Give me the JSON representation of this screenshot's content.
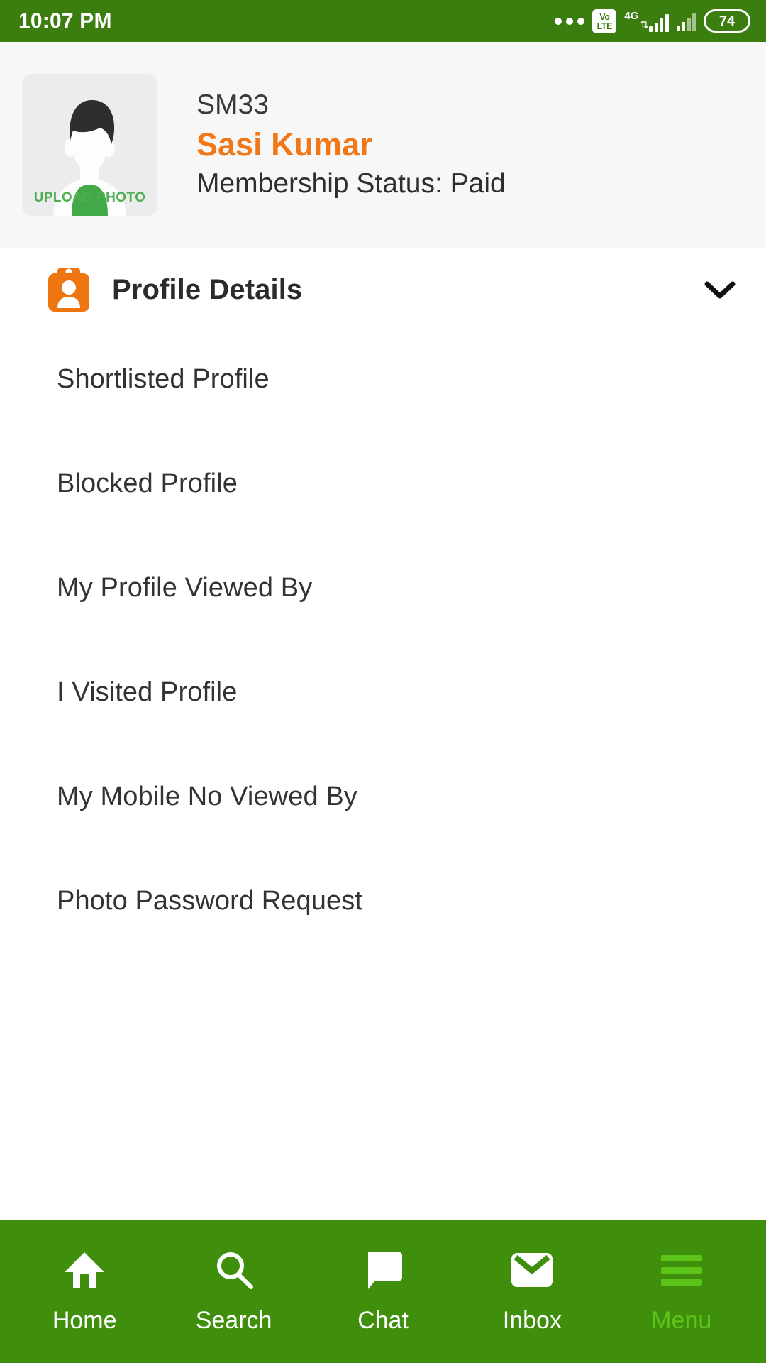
{
  "statusbar": {
    "time": "10:07 PM",
    "dots_icon": "more-horizontal-icon",
    "volte_top": "Vo",
    "volte_bottom": "LTE",
    "network_label": "4G",
    "data_arrows": "⇅",
    "signal_icon": "signal-bars-icon",
    "signal2_icon": "signal-bars-secondary-icon",
    "battery_level": "74"
  },
  "profile": {
    "avatar_icon": "user-avatar-placeholder-icon",
    "upload_photo_label": "UPLOAD PHOTO",
    "member_id": "SM33",
    "name": "Sasi Kumar",
    "membership_status": "Membership Status: Paid",
    "name_color": "#F07818",
    "upload_label_color": "#4CAF50",
    "header_bg": "#F7F7F7"
  },
  "section": {
    "icon": "id-badge-icon",
    "title": "Profile Details",
    "expand_icon": "chevron-down-icon",
    "icon_color": "#EE7510"
  },
  "menu_items": [
    {
      "label": "Shortlisted Profile",
      "name": "menu-item-shortlisted-profile"
    },
    {
      "label": "Blocked Profile",
      "name": "menu-item-blocked-profile"
    },
    {
      "label": "My Profile Viewed By",
      "name": "menu-item-my-profile-viewed-by"
    },
    {
      "label": "I Visited Profile",
      "name": "menu-item-i-visited-profile"
    },
    {
      "label": "My Mobile No Viewed By",
      "name": "menu-item-my-mobile-no-viewed-by"
    },
    {
      "label": "Photo Password Request",
      "name": "menu-item-photo-password-request"
    }
  ],
  "bottomnav": {
    "bar_color": "#3F8F0C",
    "active_color": "#5CC319",
    "items": [
      {
        "label": "Home",
        "icon": "home-icon",
        "active": false
      },
      {
        "label": "Search",
        "icon": "search-icon",
        "active": false
      },
      {
        "label": "Chat",
        "icon": "chat-bubble-icon",
        "active": false
      },
      {
        "label": "Inbox",
        "icon": "envelope-icon",
        "active": false
      },
      {
        "label": "Menu",
        "icon": "hamburger-icon",
        "active": true
      }
    ]
  }
}
